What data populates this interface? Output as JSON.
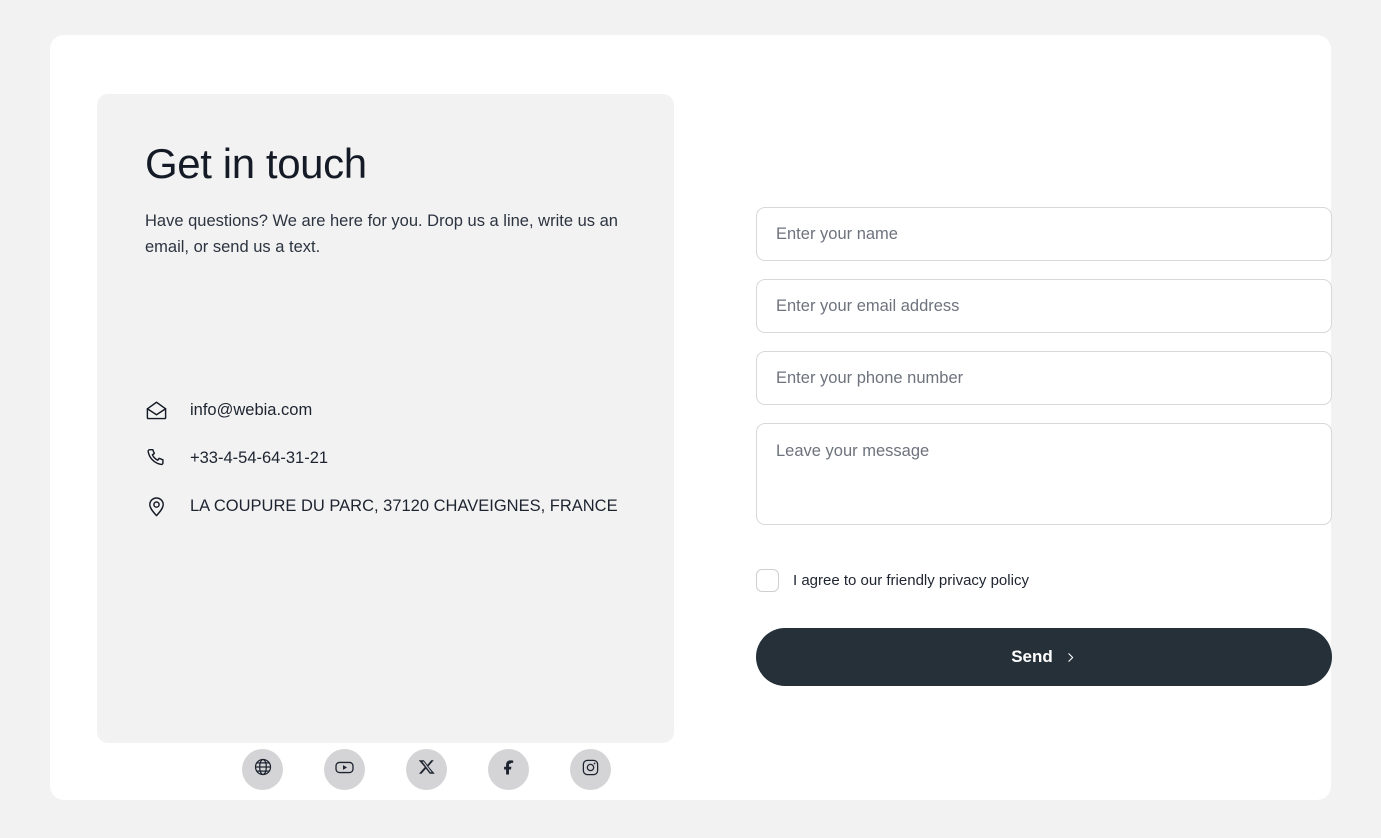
{
  "colors": {
    "page_background": "#f2f2f2",
    "card_background": "#ffffff",
    "info_panel_background": "#f2f2f2",
    "heading_text": "#151b26",
    "body_text": "#1d2430",
    "placeholder_text": "#6d737d",
    "field_border": "#d8d8d8",
    "social_button_background": "#d4d4d6",
    "send_button_background": "#253039",
    "send_button_text": "#ffffff"
  },
  "info": {
    "heading": "Get in touch",
    "subheading": "Have questions? We are here for you. Drop us a line, write us an email, or send us a text.",
    "contacts": [
      {
        "icon": "envelope-icon",
        "name": "email",
        "value": "info@webia.com"
      },
      {
        "icon": "phone-icon",
        "name": "phone",
        "value": "+33-4-54-64-31-21"
      },
      {
        "icon": "location-pin-icon",
        "name": "address",
        "value": "LA COUPURE DU PARC, 37120 CHAVEIGNES, FRANCE"
      }
    ],
    "socials": [
      {
        "icon": "globe-icon",
        "name": "website"
      },
      {
        "icon": "youtube-icon",
        "name": "youtube"
      },
      {
        "icon": "x-twitter-icon",
        "name": "x-twitter"
      },
      {
        "icon": "facebook-icon",
        "name": "facebook"
      },
      {
        "icon": "instagram-icon",
        "name": "instagram"
      }
    ]
  },
  "form": {
    "fields": [
      {
        "name": "name",
        "placeholder": "Enter your name",
        "value": ""
      },
      {
        "name": "email",
        "placeholder": "Enter your email address",
        "value": ""
      },
      {
        "name": "phone",
        "placeholder": "Enter your phone number",
        "value": ""
      }
    ],
    "message": {
      "name": "message",
      "placeholder": "Leave your message",
      "value": ""
    },
    "consent": {
      "label": "I agree to our friendly privacy policy",
      "checked": false
    },
    "submit": {
      "label": "Send",
      "icon": "chevron-right-icon"
    }
  }
}
